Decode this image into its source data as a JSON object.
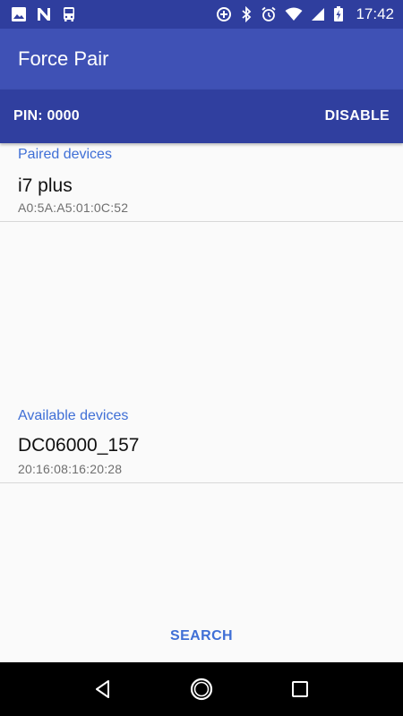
{
  "status_bar": {
    "time": "17:42",
    "left_icons": [
      "image-icon",
      "n-notification-icon",
      "bus-icon"
    ],
    "right_icons": [
      "data-saver-icon",
      "bluetooth-icon",
      "alarm-icon",
      "wifi-icon",
      "signal-icon",
      "battery-charging-icon"
    ]
  },
  "app_bar": {
    "title": "Force Pair"
  },
  "pin_bar": {
    "pin_label": "PIN: 0000",
    "disable_label": "DISABLE"
  },
  "paired": {
    "header": "Paired devices",
    "devices": [
      {
        "name": "i7 plus",
        "address": "A0:5A:A5:01:0C:52"
      }
    ]
  },
  "available": {
    "header": "Available devices",
    "devices": [
      {
        "name": "DC06000_157",
        "address": "20:16:08:16:20:28"
      }
    ]
  },
  "search": {
    "label": "SEARCH"
  },
  "nav_bar": {
    "buttons": [
      "back-icon",
      "home-icon",
      "recents-icon"
    ]
  },
  "colors": {
    "status_bar": "#2f3e9e",
    "app_bar": "#3f51b5",
    "pin_bar": "#303f9f",
    "accent_text": "#3f6fd6",
    "background": "#fafafa"
  }
}
